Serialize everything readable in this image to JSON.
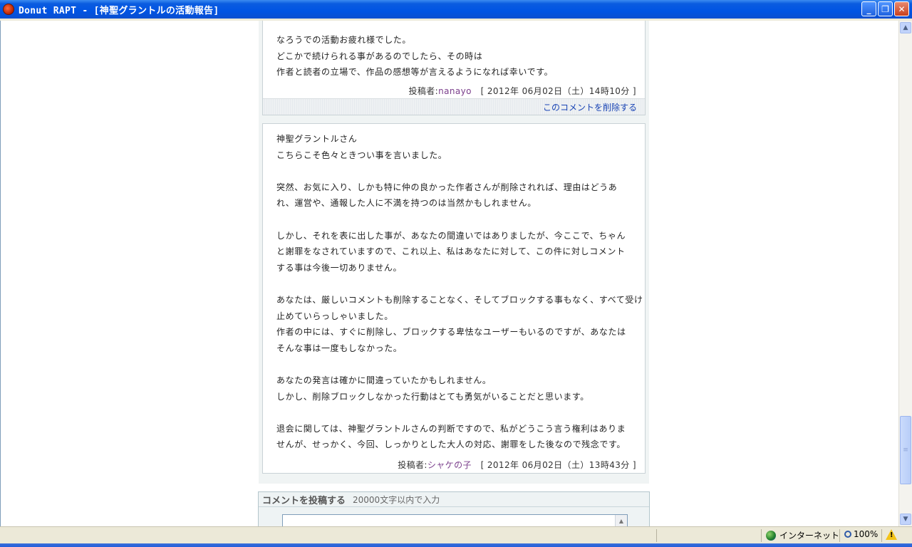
{
  "window": {
    "title": "Donut RAPT - [神聖グラントルの活動報告]",
    "buttons": {
      "minimize": "_",
      "restore": "❐",
      "close": "✕"
    }
  },
  "comments": [
    {
      "lines": [
        "なろうでの活動お疲れ様でした。",
        "どこかで続けられる事があるのでしたら、その時は",
        "作者と読者の立場で、作品の感想等が言えるようになれば幸いです。"
      ],
      "author_prefix": "投稿者:",
      "author": "nanayo",
      "timestamp": "[ 2012年 06月02日（土）14時10分 ]",
      "delete_label": "このコメントを削除する"
    },
    {
      "lines": [
        "神聖グラントルさん",
        "こちらこそ色々ときつい事を言いました。",
        "",
        "突然、お気に入り、しかも特に仲の良かった作者さんが削除されれば、理由はどうあ",
        "れ、運営や、通報した人に不満を持つのは当然かもしれません。",
        "",
        "しかし、それを表に出した事が、あなたの間違いではありましたが、今ここで、ちゃん",
        "と謝罪をなされていますので、これ以上、私はあなたに対して、この件に対しコメント",
        "する事は今後一切ありません。",
        "",
        "あなたは、厳しいコメントも削除することなく、そしてブロックする事もなく、すべて受け",
        "止めていらっしゃいました。",
        "作者の中には、すぐに削除し、ブロックする卑怯なユーザーもいるのですが、あなたは",
        "そんな事は一度もしなかった。",
        "",
        "あなたの発言は確かに間違っていたかもしれません。",
        "しかし、削除ブロックしなかった行動はとても勇気がいることだと思います。",
        "",
        "退会に関しては、神聖グラントルさんの判断ですので、私がどうこう言う権利はありま",
        "せんが、せっかく、今回、しっかりとした大人の対応、謝罪をした後なので残念です。"
      ],
      "author_prefix": "投稿者:",
      "author": "シャケの子",
      "timestamp": "[ 2012年 06月02日（土）13時43分 ]"
    }
  ],
  "post_form": {
    "heading": "コメントを投稿する",
    "hint": "20000文字以内で入力",
    "textarea_value": ""
  },
  "statusbar": {
    "zone": "インターネット",
    "zoom": "100%"
  },
  "icons": {
    "app": "donut-app-icon",
    "zone": "globe-icon",
    "zoom": "magnifier-icon",
    "warning": "warning-icon"
  }
}
